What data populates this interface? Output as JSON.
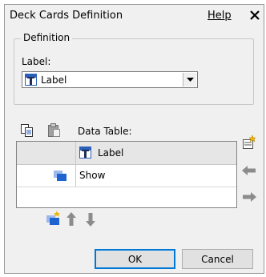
{
  "window": {
    "title": "Deck Cards Definition",
    "help_label": "Help"
  },
  "definition": {
    "group_label": "Definition",
    "label_caption": "Label:",
    "selected_value": "Label"
  },
  "data_table": {
    "caption": "Data Table:",
    "rows": [
      {
        "value": "Label"
      },
      {
        "value": "Show"
      }
    ]
  },
  "buttons": {
    "ok": "OK",
    "cancel": "Cancel"
  },
  "colors": {
    "panel_bg": "#f0f0f0",
    "accent_blue": "#1e63d0",
    "ok_border": "#0078d7",
    "arrow_gray": "#8c8c8c"
  }
}
